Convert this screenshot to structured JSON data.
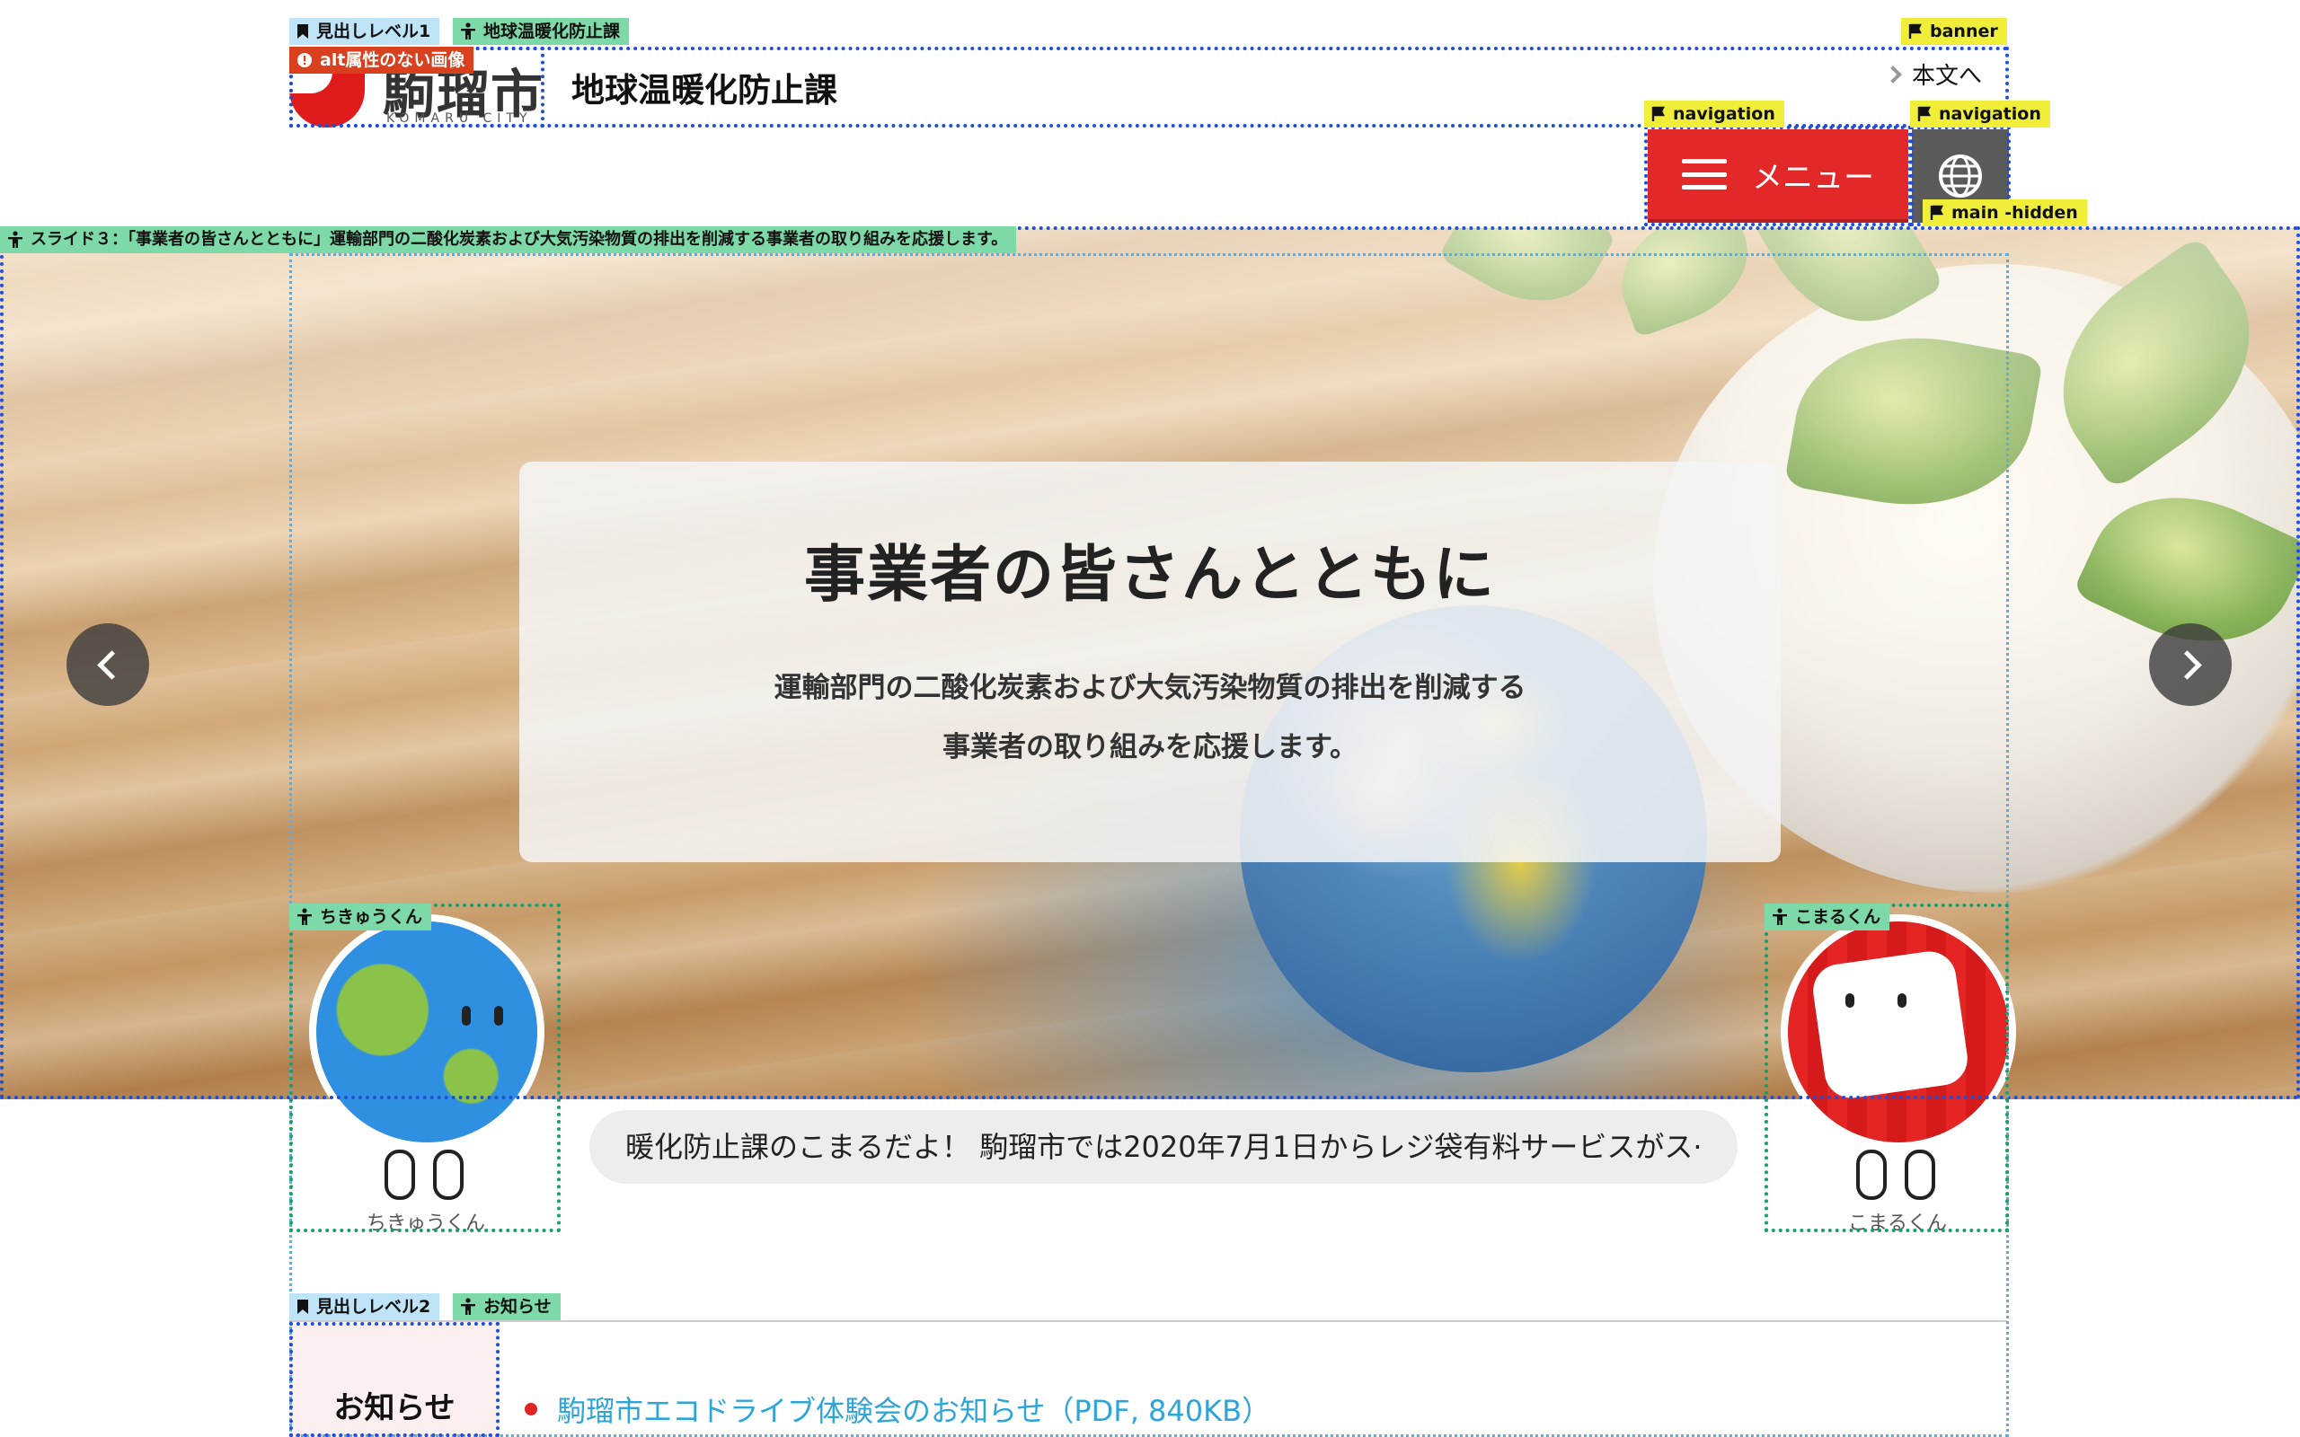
{
  "header": {
    "logo_text": "駒瑠市",
    "logo_sub": "KOMARU CITY",
    "site_title": "地球温暖化防止課",
    "skip_link": "本文へ",
    "menu_label": "メニュー"
  },
  "checker_tags": {
    "heading_level1": "見出しレベル1",
    "heading1_text": "地球温暖化防止課",
    "alt_missing": "alt属性のない画像",
    "banner": "banner",
    "navigation1": "navigation",
    "navigation2": "navigation",
    "main_hidden": "main -hidden",
    "slide_label": "スライド３：「事業者の皆さんとともに」運輸部門の二酸化炭素および大気汚染物質の排出を削減する事業者の取り組みを応援します。",
    "chikyu_alt": "ちきゅうくん",
    "komaru_alt": "こまるくん",
    "heading_level2": "見出しレベル2",
    "heading2_text": "お知らせ"
  },
  "hero": {
    "title": "事業者の皆さんとともに",
    "lines": [
      "運輸部門の二酸化炭素および大気汚染物質の排出を削減する",
      "事業者の取り組みを応援します。"
    ]
  },
  "characters": {
    "left_name": "ちきゅうくん",
    "right_name": "こまるくん"
  },
  "ticker": {
    "text": "暖化防止課のこまるだよ！ 駒瑠市では2020年7月1日からレジ袋有料サービスがス·"
  },
  "news": {
    "heading": "お知らせ",
    "items": [
      "駒瑠市エコドライブ体験会のお知らせ（PDF, 840KB）"
    ]
  },
  "colors": {
    "accent_red": "#e3282a",
    "link_blue": "#2ea5d9",
    "tag_green": "#7ed9a8",
    "tag_yellow": "#f1ee3a",
    "tag_blue": "#bfe3f7",
    "tag_red": "#d9401e"
  },
  "icons": {
    "menu": "hamburger-icon",
    "language": "globe-icon",
    "prev": "chevron-left-icon",
    "next": "chevron-right-icon",
    "landmark": "flag-icon",
    "heading": "bookmark-icon",
    "accessible": "person-icon",
    "alert": "alert-icon"
  }
}
